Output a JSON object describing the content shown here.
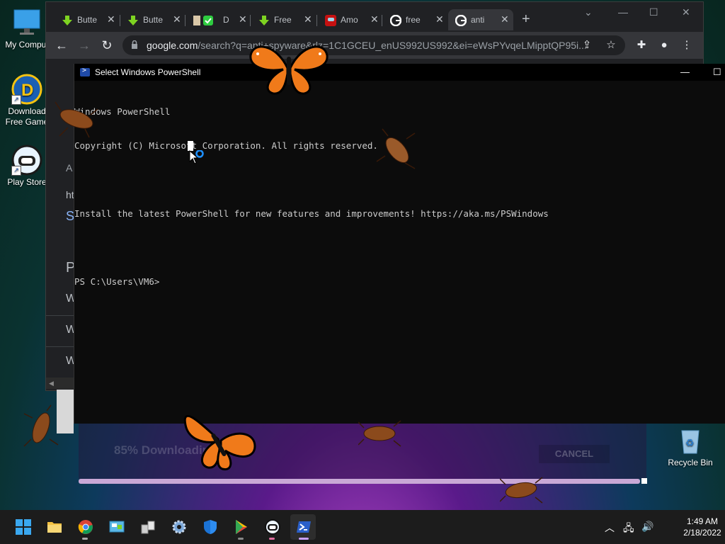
{
  "desktop": {
    "icons": [
      {
        "label": "My Comput",
        "icon": "computer-icon"
      },
      {
        "label": "Download Free Game",
        "icon": "download-game-icon"
      },
      {
        "label": "Play Store",
        "icon": "play-store-icon"
      },
      {
        "label": "Recycle Bin",
        "icon": "recycle-bin-icon"
      }
    ]
  },
  "chrome": {
    "tabs": [
      {
        "title": "Butte",
        "icon": "download-arrow-icon",
        "color": "#7ed321"
      },
      {
        "title": "Butte",
        "icon": "download-arrow-icon",
        "color": "#7ed321"
      },
      {
        "title": "D",
        "icon": "green-check-icon",
        "color": "#2ecc40"
      },
      {
        "title": "Free",
        "icon": "download-arrow-icon",
        "color": "#7ed321"
      },
      {
        "title": "Amo",
        "icon": "among-us-icon",
        "color": "#c51111"
      },
      {
        "title": "free",
        "icon": "google-icon",
        "color": "#4285f4"
      },
      {
        "title": "anti",
        "icon": "google-icon",
        "color": "#4285f4"
      }
    ],
    "url_host": "google.com",
    "url_rest": "/search?q=anti+spyware&rlz=1C1GCEU_enUS992US992&ei=eWsPYvqeLMipptQP95i...",
    "side_texts": [
      "A",
      "ht",
      "S",
      "P",
      "W",
      "W",
      "W"
    ]
  },
  "download_dialog": {
    "progress_text": "85% Downloading Us",
    "cancel_label": "CANCEL",
    "progress_fraction": 0.85
  },
  "powershell": {
    "title": "Select Windows PowerShell",
    "lines": [
      "Windows PowerShell",
      "Copyright (C) Microsoft Corporation. All rights reserved.",
      "",
      "Install the latest PowerShell for new features and improvements! https://aka.ms/PSWindows",
      "",
      "PS C:\\Users\\VM6> "
    ]
  },
  "taskbar": {
    "apps": [
      {
        "name": "start",
        "icon": "windows-start-icon"
      },
      {
        "name": "file-explorer",
        "icon": "folder-icon"
      },
      {
        "name": "chrome",
        "icon": "chrome-icon"
      },
      {
        "name": "control-panel",
        "icon": "control-panel-icon"
      },
      {
        "name": "network",
        "icon": "network-computers-icon"
      },
      {
        "name": "settings",
        "icon": "gear-icon"
      },
      {
        "name": "defender",
        "icon": "shield-icon"
      },
      {
        "name": "play-store",
        "icon": "play-store-icon"
      },
      {
        "name": "game",
        "icon": "game-face-icon"
      },
      {
        "name": "powershell",
        "icon": "powershell-icon"
      }
    ],
    "time": "1:49 AM",
    "date": "2/18/2022"
  },
  "colors": {
    "powershell_bg": "#0c0c0c",
    "chrome_dark": "#202124",
    "taskbar": "#1c1c1c"
  }
}
